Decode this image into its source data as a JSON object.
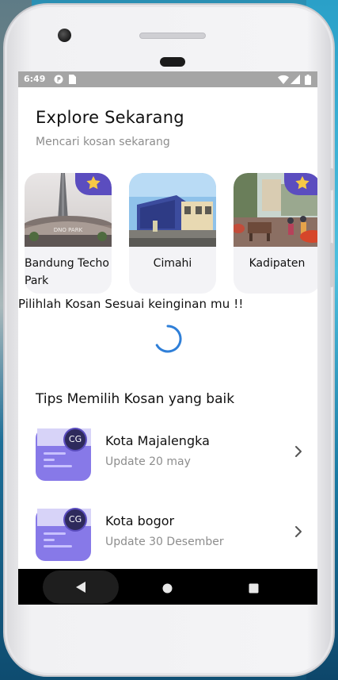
{
  "status_bar": {
    "time": "6:49",
    "icons": [
      "p-badge-icon",
      "sim-card-icon",
      "wifi-icon",
      "signal-icon",
      "battery-icon"
    ]
  },
  "header": {
    "title": "Explore Sekarang",
    "subtitle": "Mencari kosan sekarang"
  },
  "cities": [
    {
      "name": "Bandung Techo Park",
      "starred": true,
      "image_icon": "tower-photo"
    },
    {
      "name": "Cimahi",
      "starred": false,
      "image_icon": "building-photo"
    },
    {
      "name": "Kadipaten",
      "starred": true,
      "image_icon": "street-photo"
    }
  ],
  "prompt": "Pilihlah Kosan Sesuai keinginan mu !!",
  "tips": {
    "title": "Tips Memilih Kosan yang baik",
    "items": [
      {
        "name": "Kota Majalengka",
        "date": "Update 20 may",
        "badge": "CG"
      },
      {
        "name": "Kota bogor",
        "date": "Update 30 Desember",
        "badge": "CG"
      }
    ]
  },
  "colors": {
    "accent": "#5b4dbf",
    "thumb_bg": "#8779e8",
    "star": "#f6c945",
    "spinner": "#2f7fd8",
    "status_bar": "#a5a5a5",
    "nav_bar": "#000000"
  },
  "nav": {
    "back": "back-icon",
    "home": "home-icon",
    "recents": "recents-icon"
  }
}
